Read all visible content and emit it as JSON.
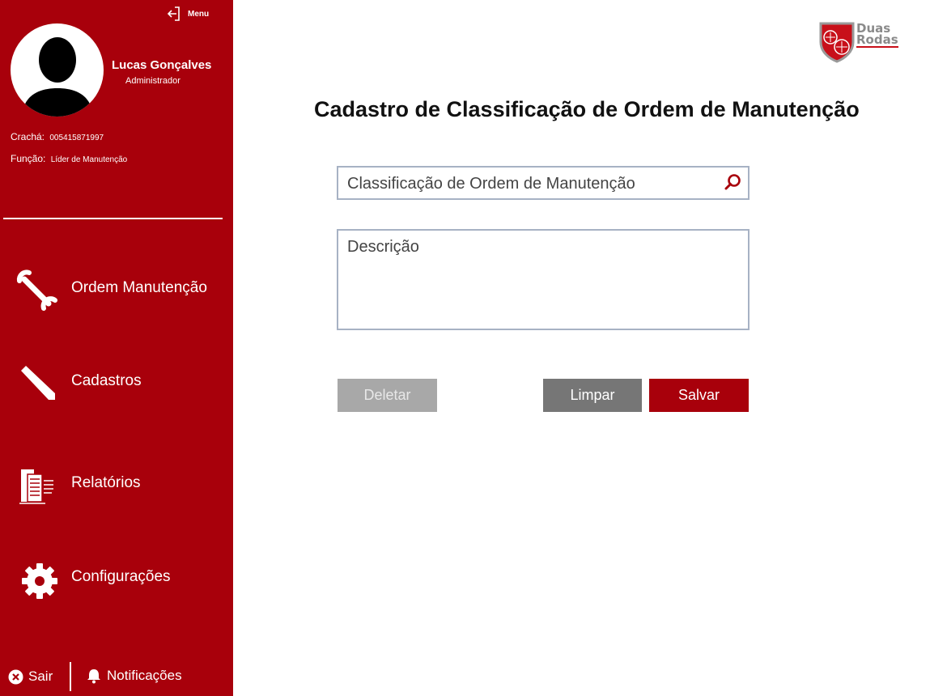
{
  "sidebar": {
    "menu_label": "Menu",
    "user": {
      "name": "Lucas Gonçalves",
      "role": "Administrador",
      "badge_label": "Crachá:",
      "badge_value": "005415871997",
      "function_label": "Função:",
      "function_value": "Líder de Manutenção"
    },
    "nav": [
      {
        "label": "Ordem Manutenção",
        "icon": "wrench-icon"
      },
      {
        "label": "Cadastros",
        "icon": "pencil-icon"
      },
      {
        "label": "Relatórios",
        "icon": "report-icon"
      },
      {
        "label": "Configurações",
        "icon": "gear-icon"
      }
    ],
    "footer": {
      "logout_label": "Sair",
      "notifications_label": "Notificações"
    }
  },
  "logo": {
    "line1": "Duas",
    "line2": "Rodas"
  },
  "main": {
    "title": "Cadastro de Classificação de Ordem de Manutenção",
    "search": {
      "placeholder": "Classificação de Ordem de Manutenção",
      "value": ""
    },
    "description": {
      "placeholder": "Descrição",
      "value": ""
    },
    "buttons": {
      "delete": "Deletar",
      "clear": "Limpar",
      "save": "Salvar"
    }
  },
  "colors": {
    "brand": "#a8000b",
    "disabled": "#a8a8a8",
    "secondary": "#767676",
    "field_border": "#a7b2c4"
  }
}
